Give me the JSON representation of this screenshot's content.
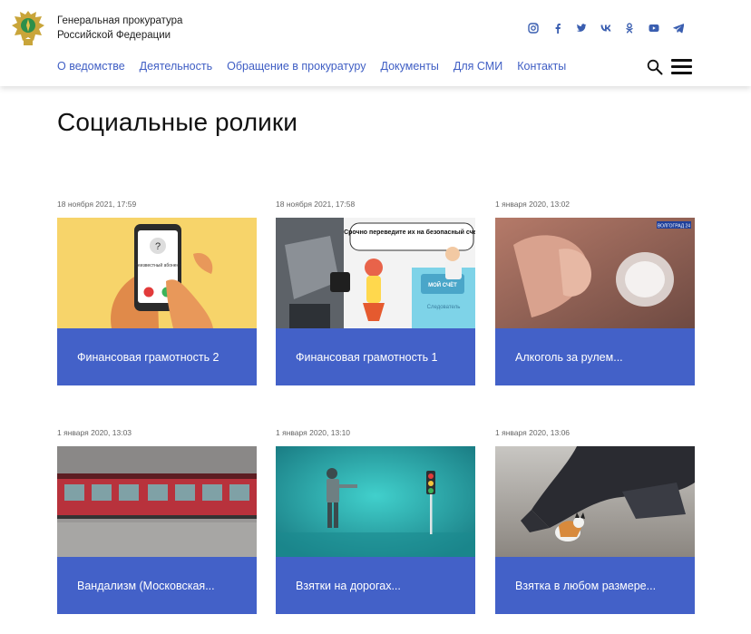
{
  "header": {
    "org_line1": "Генеральная прокуратура",
    "org_line2": "Российской Федерации",
    "social": [
      "instagram-icon",
      "facebook-icon",
      "twitter-icon",
      "vk-icon",
      "odnoklassniki-icon",
      "youtube-icon",
      "telegram-icon"
    ],
    "nav": [
      "О ведомстве",
      "Деятельность",
      "Обращение в прокуратуру",
      "Документы",
      "Для СМИ",
      "Контакты"
    ]
  },
  "page_title": "Социальные ролики",
  "cards": [
    {
      "date": "18 ноября 2021, 17:59",
      "title": "Финансовая грамотность 2",
      "thumb_label": "Неизвестный абонент"
    },
    {
      "date": "18 ноября 2021, 17:58",
      "title": "Финансовая грамотность 1",
      "thumb_label": "Срочно переведите их на безопасный счет",
      "thumb_label2": "МОЙ СЧЁТ",
      "thumb_label3": "Следователь"
    },
    {
      "date": "1 января 2020, 13:02",
      "title": "Алкоголь за рулем...",
      "thumb_label": "ВОЛГОГРАД 24"
    },
    {
      "date": "1 января 2020, 13:03",
      "title": "Вандализм (Московская..."
    },
    {
      "date": "1 января 2020, 13:10",
      "title": "Взятки на дорогах..."
    },
    {
      "date": "1 января 2020, 13:06",
      "title": "Взятка в любом размере..."
    }
  ],
  "colors": {
    "accent": "#4361c8",
    "nav": "#3f5ec4",
    "social": "#3a5eb0"
  }
}
